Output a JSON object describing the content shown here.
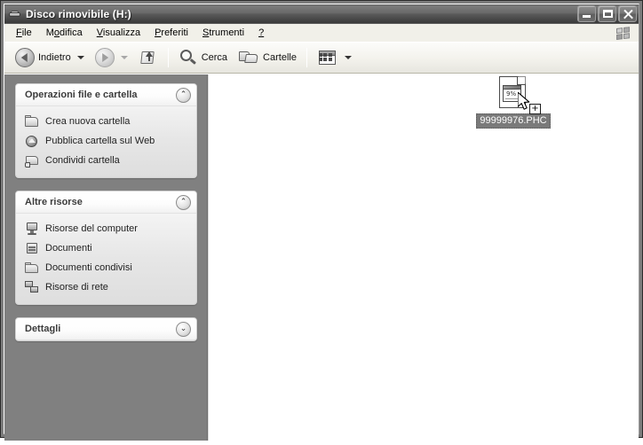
{
  "window": {
    "title": "Disco rimovibile (H:)",
    "title_icon": "removable-disk-icon",
    "minimize_label": "Riduci a icona",
    "maximize_label": "Ingrandisci",
    "close_label": "Chiudi"
  },
  "menubar": {
    "items": [
      {
        "label": "File",
        "accel": "F"
      },
      {
        "label": "Modifica",
        "accel": "M"
      },
      {
        "label": "Visualizza",
        "accel": "V"
      },
      {
        "label": "Preferiti",
        "accel": "P"
      },
      {
        "label": "Strumenti",
        "accel": "S"
      },
      {
        "label": "?",
        "accel": "?"
      }
    ],
    "right_logo": "windows-flag-icon"
  },
  "toolbar": {
    "back_label": "Indietro",
    "forward_label": "",
    "up_label": "",
    "search_label": "Cerca",
    "folders_label": "Cartelle",
    "views_label": ""
  },
  "sidebar": {
    "panels": [
      {
        "title": "Operazioni file e cartella",
        "collapsed": false,
        "chevron": "⌃",
        "items": [
          {
            "label": "Crea nuova cartella",
            "icon": "folder-icon"
          },
          {
            "label": "Pubblica cartella sul Web",
            "icon": "globe-publish-icon"
          },
          {
            "label": "Condividi cartella",
            "icon": "share-folder-icon"
          }
        ]
      },
      {
        "title": "Altre risorse",
        "collapsed": false,
        "chevron": "⌃",
        "items": [
          {
            "label": "Risorse del computer",
            "icon": "computer-icon"
          },
          {
            "label": "Documenti",
            "icon": "documents-icon"
          },
          {
            "label": "Documenti condivisi",
            "icon": "shared-documents-icon"
          },
          {
            "label": "Risorse di rete",
            "icon": "network-icon"
          }
        ]
      },
      {
        "title": "Dettagli",
        "collapsed": true,
        "chevron": "⌄",
        "items": []
      }
    ]
  },
  "content": {
    "files": [
      {
        "name": "99999976.PHC",
        "icon": "document-window-icon",
        "selected": true
      }
    ],
    "drag": {
      "badge": "+",
      "cursor": "drag-copy-cursor"
    }
  },
  "colors": {
    "sidebar_bg": "#808080",
    "content_bg": "#ffffff",
    "titlebar_dark": "#3f3f3f",
    "selection_bg": "#7a7a7a",
    "menubar_bg": "#f1f0e9"
  }
}
